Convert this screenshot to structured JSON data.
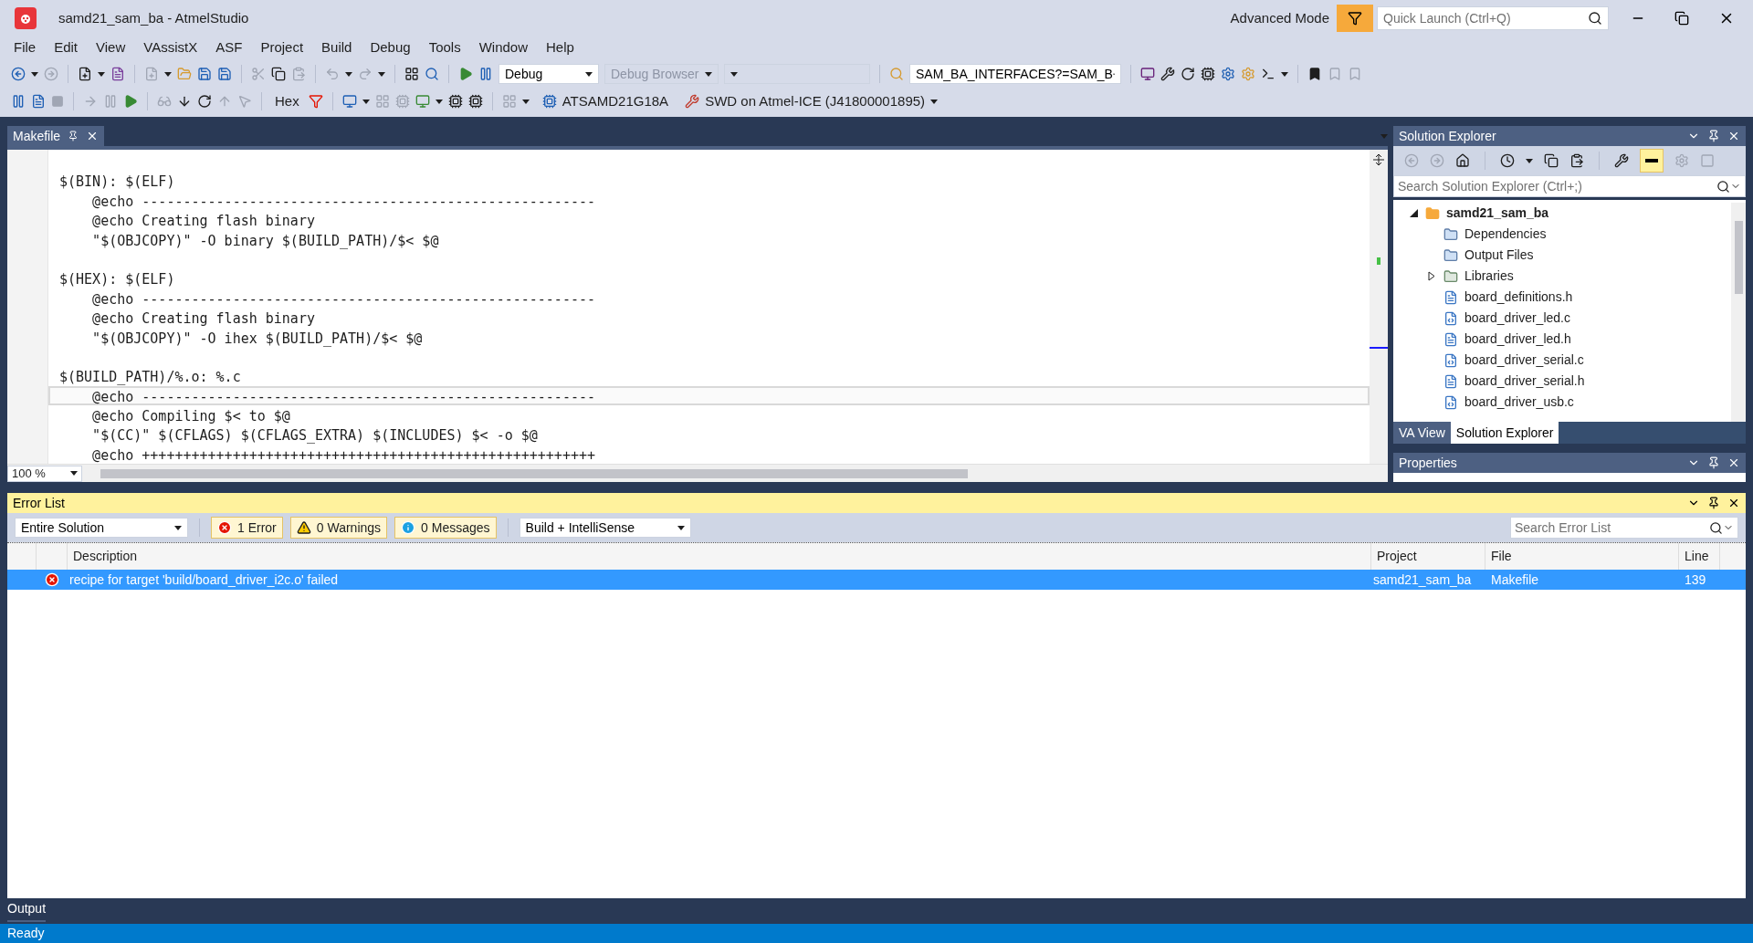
{
  "window": {
    "title": "samd21_sam_ba - AtmelStudio",
    "mode": "Advanced Mode",
    "quick_launch": {
      "placeholder": "Quick Launch (Ctrl+Q)"
    }
  },
  "menu": [
    "File",
    "Edit",
    "View",
    "VAssistX",
    "ASF",
    "Project",
    "Build",
    "Debug",
    "Tools",
    "Window",
    "Help"
  ],
  "toolbar_1": {
    "configuration": "Debug",
    "debug_browser": "Debug Browser",
    "make_variable": "SAM_BA_INTERFACES?=SAM_B"
  },
  "toolbar_2": {
    "hex": "Hex",
    "device": "ATSAMD21G18A",
    "tool": "SWD on Atmel-ICE (J41800001895)"
  },
  "editor": {
    "tab": "Makefile",
    "zoom": "100 %",
    "lines": [
      {
        "current": false
      },
      {
        "text": "$(BIN): $(ELF)",
        "current": false
      },
      {
        "text": "    @echo -------------------------------------------------------",
        "current": false
      },
      {
        "text": "    @echo Creating flash binary",
        "current": false
      },
      {
        "text": "    \"$(OBJCOPY)\" -O binary $(BUILD_PATH)/$< $@",
        "current": false
      },
      {
        "current": false
      },
      {
        "text": "$(HEX): $(ELF)",
        "current": false
      },
      {
        "text": "    @echo -------------------------------------------------------",
        "current": false
      },
      {
        "text": "    @echo Creating flash binary",
        "current": false
      },
      {
        "text": "    \"$(OBJCOPY)\" -O ihex $(BUILD_PATH)/$< $@",
        "current": false
      },
      {
        "current": false
      },
      {
        "text": "$(BUILD_PATH)/%.o: %.c",
        "current": false
      },
      {
        "text": "    @echo -------------------------------------------------------",
        "current": true
      },
      {
        "text": "    @echo Compiling $< to $@",
        "current": false
      },
      {
        "text": "    \"$(CC)\" $(CFLAGS) $(CFLAGS_EXTRA) $(INCLUDES) $< -o $@",
        "current": false
      },
      {
        "text": "    @echo +++++++++++++++++++++++++++++++++++++++++++++++++++++++",
        "current": false
      }
    ]
  },
  "solution_explorer": {
    "title": "Solution Explorer",
    "search": {
      "placeholder": "Search Solution Explorer (Ctrl+;)"
    },
    "tree": [
      {
        "label": "samd21_sam_ba",
        "kind": "project",
        "expanded": true,
        "children": [
          {
            "label": "Dependencies",
            "kind": "folder"
          },
          {
            "label": "Output Files",
            "kind": "folder"
          },
          {
            "label": "Libraries",
            "kind": "library",
            "expanded": false
          },
          {
            "label": "board_definitions.h",
            "kind": "header"
          },
          {
            "label": "board_driver_led.c",
            "kind": "source"
          },
          {
            "label": "board_driver_led.h",
            "kind": "header"
          },
          {
            "label": "board_driver_serial.c",
            "kind": "source"
          },
          {
            "label": "board_driver_serial.h",
            "kind": "header"
          },
          {
            "label": "board_driver_usb.c",
            "kind": "source"
          }
        ]
      }
    ],
    "tabs": [
      {
        "label": "VA View",
        "selected": false
      },
      {
        "label": "Solution Explorer",
        "selected": true
      }
    ]
  },
  "properties": {
    "title": "Properties"
  },
  "error_list": {
    "title": "Error List",
    "scope": "Entire Solution",
    "filters": [
      {
        "label": "1 Error",
        "kind": "error",
        "selected": true
      },
      {
        "label": "0 Warnings",
        "kind": "warning",
        "selected": true
      },
      {
        "label": "0 Messages",
        "kind": "message",
        "selected": true
      }
    ],
    "source": "Build + IntelliSense",
    "search": {
      "placeholder": "Search Error List"
    },
    "columns": [
      "Description",
      "Project",
      "File",
      "Line"
    ],
    "rows": [
      {
        "kind": "error",
        "description": "recipe for target 'build/board_driver_i2c.o' failed",
        "project": "samd21_sam_ba",
        "file": "Makefile",
        "line": "139",
        "selected": true
      }
    ]
  },
  "output_tab": "Output",
  "status_bar": "Ready"
}
